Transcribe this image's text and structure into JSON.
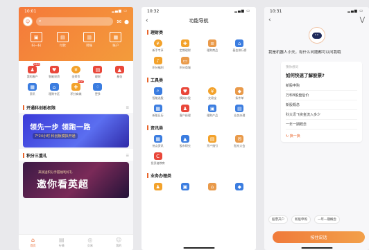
{
  "phone1": {
    "time": "10:01",
    "status_right": "▮▮ ▮",
    "search_placeholder": "",
    "quick": [
      {
        "icon": "scan-icon",
        "label": "扫一扫"
      },
      {
        "icon": "card-icon",
        "label": "付款"
      },
      {
        "icon": "transfer-icon",
        "label": "转账"
      },
      {
        "icon": "account-icon",
        "label": "账户"
      }
    ],
    "grid": [
      {
        "icon": "user-icon",
        "label": "我的客户",
        "color": "#e9473a",
        "badge": "NEW"
      },
      {
        "icon": "heart-icon",
        "label": "智能投资",
        "color": "#e9473a"
      },
      {
        "icon": "coin-icon",
        "label": "金荣币",
        "color": "#f3a22b"
      },
      {
        "icon": "folder-icon",
        "label": "理财",
        "color": "#e9473a"
      },
      {
        "icon": "chart-icon",
        "label": "基金",
        "color": "#e9473a"
      },
      {
        "icon": "news-icon",
        "label": "资讯",
        "color": "#3b7de0"
      },
      {
        "icon": "bank-icon",
        "label": "理财专区",
        "color": "#3b7de0"
      },
      {
        "icon": "gift-icon",
        "label": "积分商城",
        "color": "#f3a22b",
        "badge": "HOT"
      },
      {
        "icon": "grid-icon",
        "label": "更多",
        "color": "#3b7de0"
      }
    ],
    "section1": "开通科创板权限",
    "banner1_big": "领先一步 领跑一路",
    "banner1_small": "7*24小时 科创板模拟开通",
    "section2": "积分三重礼",
    "banner2_tiny": "来就送积分手握福利好礼",
    "banner2_big": "邀你看英超",
    "tabs": [
      {
        "icon": "home-icon",
        "label": "首页"
      },
      {
        "icon": "market-icon",
        "label": "行情"
      },
      {
        "icon": "trade-icon",
        "label": "交易"
      },
      {
        "icon": "me-icon",
        "label": "我的"
      }
    ]
  },
  "phone2": {
    "time": "10:32",
    "title": "功能导航",
    "categories": [
      {
        "name": "理财类",
        "items": [
          {
            "icon": "coin-icon",
            "label": "新手专享",
            "color": "#f3a22b"
          },
          {
            "icon": "gift-icon",
            "label": "定期理财",
            "color": "#f3a22b"
          },
          {
            "icon": "doc-icon",
            "label": "理财商品",
            "color": "#e99a4a"
          },
          {
            "icon": "bank-icon",
            "label": "基金排行榜",
            "color": "#3b7de0"
          },
          {
            "icon": "bell-icon",
            "label": "积分福利",
            "color": "#f3a22b"
          },
          {
            "icon": "clip-icon",
            "label": "积分商城",
            "color": "#e99a4a"
          }
        ]
      },
      {
        "name": "工具类",
        "items": [
          {
            "icon": "search-icon",
            "label": "智能选股",
            "color": "#3b7de0"
          },
          {
            "icon": "heart-icon",
            "label": "模拟炒股",
            "color": "#e9473a"
          },
          {
            "icon": "coin-icon",
            "label": "交易宝",
            "color": "#f3a22b"
          },
          {
            "icon": "shield-icon",
            "label": "条件单",
            "color": "#e99a4a"
          },
          {
            "icon": "calendar-icon",
            "label": "新股日历",
            "color": "#3b7de0"
          },
          {
            "icon": "people-icon",
            "label": "客户经理",
            "color": "#e9473a"
          },
          {
            "icon": "lock-icon",
            "label": "理财产品",
            "color": "#3b7de0"
          },
          {
            "icon": "book-icon",
            "label": "业务办理",
            "color": "#3b7de0"
          }
        ]
      },
      {
        "name": "资讯类",
        "items": [
          {
            "icon": "news-icon",
            "label": "热点资讯",
            "color": "#3b7de0"
          },
          {
            "icon": "chart-icon",
            "label": "股市研究",
            "color": "#3b7de0"
          },
          {
            "icon": "folder-icon",
            "label": "开户指引",
            "color": "#f3a22b"
          },
          {
            "icon": "mail-icon",
            "label": "股东大会",
            "color": "#e99a4a"
          },
          {
            "icon": "c-icon",
            "label": "投资者教育",
            "color": "#e9473a"
          }
        ]
      },
      {
        "name": "业务办理类",
        "items": [
          {
            "icon": "user-icon",
            "label": "",
            "color": "#f3a22b"
          },
          {
            "icon": "lock-icon",
            "label": "",
            "color": "#3b7de0"
          },
          {
            "icon": "bank-icon",
            "label": "",
            "color": "#e99a4a"
          },
          {
            "icon": "shield-icon",
            "label": "",
            "color": "#3b7de0"
          }
        ]
      }
    ]
  },
  "phone3": {
    "time": "10:31",
    "greeting": "我是机器人小天，有什么问题都可以问我哦",
    "card_tag": "猜你想问",
    "card_title": "如何快速了解股票?",
    "questions": [
      "新股申购",
      "万科B股盘后价",
      "新股概念",
      "科大讯飞资金流入多少",
      "一年一期概念"
    ],
    "refresh": "换一换",
    "chips": [
      "股票开户",
      "新股申购",
      "一年一期概念"
    ],
    "input_label": "按住说话"
  }
}
